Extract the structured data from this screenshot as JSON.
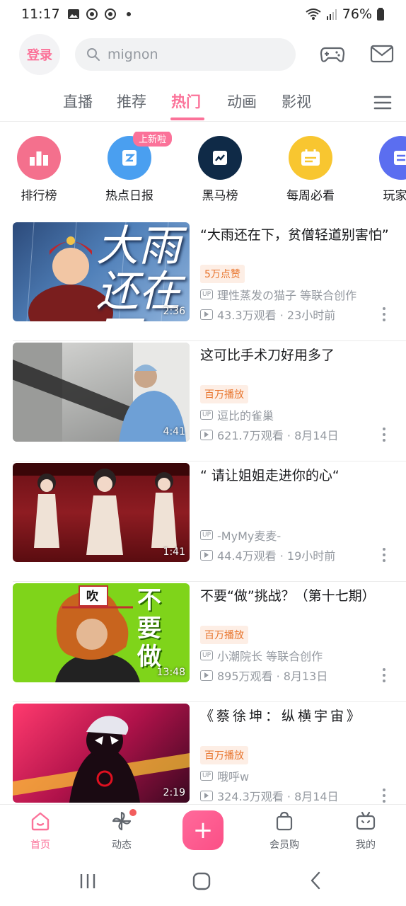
{
  "status": {
    "time": "11:17",
    "battery": "76%"
  },
  "header": {
    "login_label": "登录",
    "search_placeholder": "mignon"
  },
  "tabs": [
    {
      "label": "直播"
    },
    {
      "label": "推荐"
    },
    {
      "label": "热门"
    },
    {
      "label": "动画"
    },
    {
      "label": "影视"
    }
  ],
  "active_tab": "热门",
  "categories": [
    {
      "label": "排行榜",
      "color": "#f4708d"
    },
    {
      "label": "热点日报",
      "color": "#4a9ff0",
      "badge": "上新啦"
    },
    {
      "label": "黑马榜",
      "color": "#0f2a47"
    },
    {
      "label": "每周必看",
      "color": "#f8c630"
    },
    {
      "label": "玩家排",
      "color": "#5b6ef0"
    }
  ],
  "feed": [
    {
      "title": "“大雨还在下，贫僧轻道别害怕”",
      "tag": "5万点赞",
      "up": "理性蒸发の猫子 等联合创作",
      "views": "43.3万观看 · 23小时前",
      "duration": "2:36"
    },
    {
      "title": "这可比手术刀好用多了",
      "tag": "百万播放",
      "up": "逗比的雀巢",
      "views": "621.7万观看 · 8月14日",
      "duration": "4:41"
    },
    {
      "title": "“ 请让姐姐走进你的心“",
      "tag": "",
      "up": "-MyMy麦麦-",
      "views": "44.4万观看 · 19小时前",
      "duration": "1:41"
    },
    {
      "title": "不要“做”挑战？（第十七期）",
      "tag": "百万播放",
      "up": "小潮院长 等联合创作",
      "views": "895万观看 · 8月13日",
      "duration": "13:48"
    },
    {
      "title": "《蔡徐坤：纵横宇宙》",
      "tag": "百万播放",
      "up": "哦呼w",
      "views": "324.3万观看 · 8月14日",
      "duration": "2:19"
    }
  ],
  "thumb_text": {
    "t1": "大雨还在下",
    "t4a": "吹",
    "t4b": "不要做"
  },
  "bottom_nav": [
    {
      "label": "首页"
    },
    {
      "label": "动态"
    },
    {
      "label": "会员购"
    },
    {
      "label": "我的"
    }
  ],
  "colors": {
    "accent": "#fb7299",
    "tag_text": "#e8742c",
    "meta": "#9499a0"
  }
}
